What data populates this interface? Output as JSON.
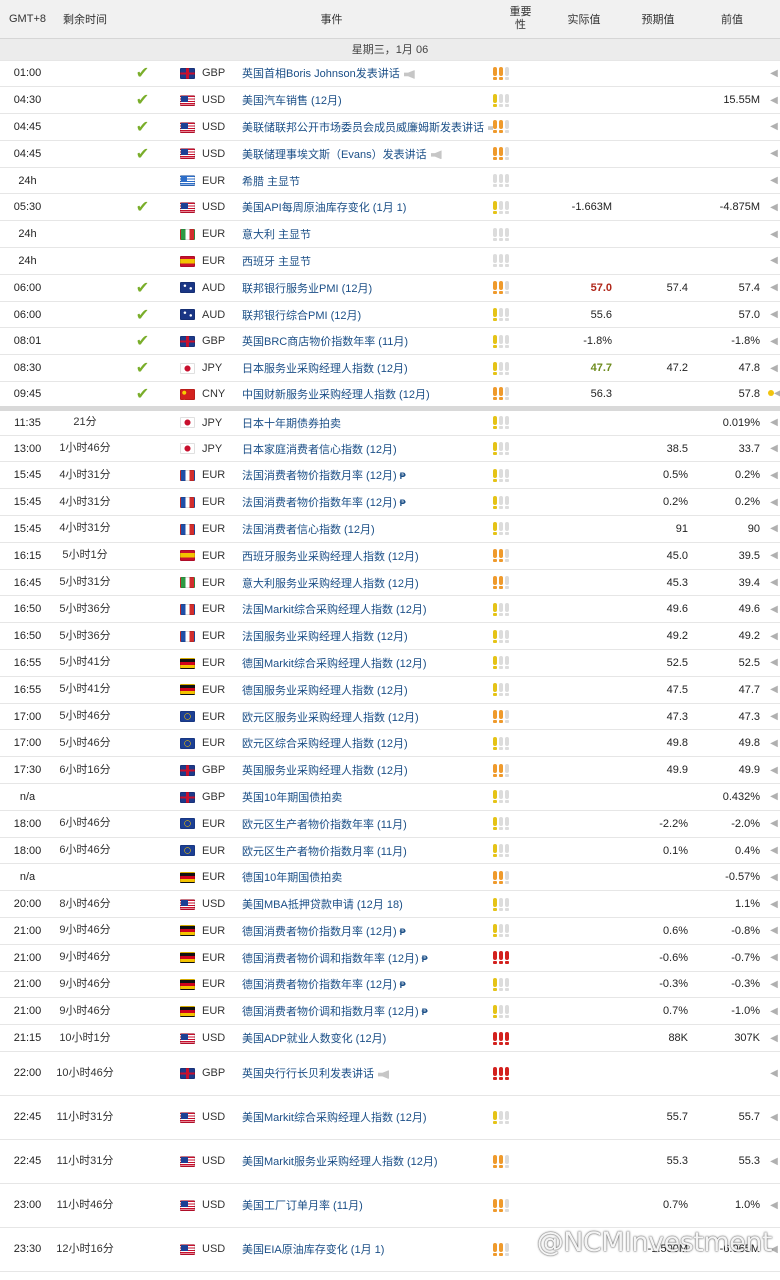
{
  "header": {
    "tz": "GMT+8",
    "remaining": "剩余时间",
    "event": "事件",
    "importance": "重要性",
    "actual": "实际值",
    "forecast": "预期值",
    "previous": "前值"
  },
  "date_label": "星期三，1月 06",
  "rows": [
    {
      "time": "01:00",
      "rem": "",
      "done": true,
      "flag": "gb",
      "cur": "GBP",
      "event": "英国首相Boris Johnson发表讲话",
      "speech": true,
      "p": false,
      "imp": "med",
      "act": "",
      "act_color": "",
      "fc": "",
      "prev": "",
      "dot": false
    },
    {
      "time": "04:30",
      "rem": "",
      "done": true,
      "flag": "us",
      "cur": "USD",
      "event": "美国汽车销售 (12月)",
      "speech": false,
      "p": false,
      "imp": "low",
      "act": "",
      "act_color": "",
      "fc": "",
      "prev": "15.55M",
      "dot": false
    },
    {
      "time": "04:45",
      "rem": "",
      "done": true,
      "flag": "us",
      "cur": "USD",
      "event": "美联储联邦公开市场委员会成员威廉姆斯发表讲话",
      "speech": true,
      "p": false,
      "imp": "med",
      "act": "",
      "act_color": "",
      "fc": "",
      "prev": "",
      "dot": false
    },
    {
      "time": "04:45",
      "rem": "",
      "done": true,
      "flag": "us",
      "cur": "USD",
      "event": "美联储理事埃文斯（Evans）发表讲话",
      "speech": true,
      "p": false,
      "imp": "med",
      "act": "",
      "act_color": "",
      "fc": "",
      "prev": "",
      "dot": false
    },
    {
      "time": "24h",
      "rem": "",
      "done": false,
      "flag": "gr",
      "cur": "EUR",
      "event": "希腊 主显节",
      "speech": false,
      "p": false,
      "imp": "none",
      "act": "",
      "act_color": "",
      "fc": "",
      "prev": "",
      "dot": false
    },
    {
      "time": "05:30",
      "rem": "",
      "done": true,
      "flag": "us",
      "cur": "USD",
      "event": "美国API每周原油库存变化 (1月 1)",
      "speech": false,
      "p": false,
      "imp": "low",
      "act": "-1.663M",
      "act_color": "",
      "fc": "",
      "prev": "-4.875M",
      "dot": false
    },
    {
      "time": "24h",
      "rem": "",
      "done": false,
      "flag": "it",
      "cur": "EUR",
      "event": "意大利 主显节",
      "speech": false,
      "p": false,
      "imp": "none",
      "act": "",
      "act_color": "",
      "fc": "",
      "prev": "",
      "dot": false
    },
    {
      "time": "24h",
      "rem": "",
      "done": false,
      "flag": "es",
      "cur": "EUR",
      "event": "西班牙 主显节",
      "speech": false,
      "p": false,
      "imp": "none",
      "act": "",
      "act_color": "",
      "fc": "",
      "prev": "",
      "dot": false
    },
    {
      "time": "06:00",
      "rem": "",
      "done": true,
      "flag": "au",
      "cur": "AUD",
      "event": "联邦银行服务业PMI (12月)",
      "speech": false,
      "p": false,
      "imp": "med",
      "act": "57.0",
      "act_color": "red",
      "fc": "57.4",
      "prev": "57.4",
      "dot": false
    },
    {
      "time": "06:00",
      "rem": "",
      "done": true,
      "flag": "au",
      "cur": "AUD",
      "event": "联邦银行综合PMI (12月)",
      "speech": false,
      "p": false,
      "imp": "low",
      "act": "55.6",
      "act_color": "",
      "fc": "",
      "prev": "57.0",
      "dot": false
    },
    {
      "time": "08:01",
      "rem": "",
      "done": true,
      "flag": "gb",
      "cur": "GBP",
      "event": "英国BRC商店物价指数年率 (11月)",
      "speech": false,
      "p": false,
      "imp": "low",
      "act": "-1.8%",
      "act_color": "",
      "fc": "",
      "prev": "-1.8%",
      "dot": false
    },
    {
      "time": "08:30",
      "rem": "",
      "done": true,
      "flag": "jp",
      "cur": "JPY",
      "event": "日本服务业采购经理人指数 (12月)",
      "speech": false,
      "p": false,
      "imp": "low",
      "act": "47.7",
      "act_color": "green",
      "fc": "47.2",
      "prev": "47.8",
      "dot": false
    },
    {
      "time": "09:45",
      "rem": "",
      "done": true,
      "flag": "cn",
      "cur": "CNY",
      "event": "中国财新服务业采购经理人指数 (12月)",
      "speech": false,
      "p": false,
      "imp": "med",
      "act": "56.3",
      "act_color": "",
      "fc": "",
      "prev": "57.8",
      "dot": true
    },
    {
      "time": "11:35",
      "rem": "21分",
      "done": false,
      "flag": "jp",
      "cur": "JPY",
      "event": "日本十年期债券拍卖",
      "speech": false,
      "p": false,
      "imp": "low",
      "act": "",
      "act_color": "",
      "fc": "",
      "prev": "0.019%",
      "dot": false,
      "sep": true
    },
    {
      "time": "13:00",
      "rem": "1小时46分",
      "done": false,
      "flag": "jp",
      "cur": "JPY",
      "event": "日本家庭消费者信心指数 (12月)",
      "speech": false,
      "p": false,
      "imp": "low",
      "act": "",
      "act_color": "",
      "fc": "38.5",
      "prev": "33.7",
      "dot": false
    },
    {
      "time": "15:45",
      "rem": "4小时31分",
      "done": false,
      "flag": "fr",
      "cur": "EUR",
      "event": "法国消费者物价指数月率 (12月)",
      "speech": false,
      "p": true,
      "imp": "low",
      "act": "",
      "act_color": "",
      "fc": "0.5%",
      "prev": "0.2%",
      "dot": false
    },
    {
      "time": "15:45",
      "rem": "4小时31分",
      "done": false,
      "flag": "fr",
      "cur": "EUR",
      "event": "法国消费者物价指数年率 (12月)",
      "speech": false,
      "p": true,
      "imp": "low",
      "act": "",
      "act_color": "",
      "fc": "0.2%",
      "prev": "0.2%",
      "dot": false
    },
    {
      "time": "15:45",
      "rem": "4小时31分",
      "done": false,
      "flag": "fr",
      "cur": "EUR",
      "event": "法国消费者信心指数 (12月)",
      "speech": false,
      "p": false,
      "imp": "low",
      "act": "",
      "act_color": "",
      "fc": "91",
      "prev": "90",
      "dot": false
    },
    {
      "time": "16:15",
      "rem": "5小时1分",
      "done": false,
      "flag": "es",
      "cur": "EUR",
      "event": "西班牙服务业采购经理人指数 (12月)",
      "speech": false,
      "p": false,
      "imp": "med",
      "act": "",
      "act_color": "",
      "fc": "45.0",
      "prev": "39.5",
      "dot": false
    },
    {
      "time": "16:45",
      "rem": "5小时31分",
      "done": false,
      "flag": "it",
      "cur": "EUR",
      "event": "意大利服务业采购经理人指数 (12月)",
      "speech": false,
      "p": false,
      "imp": "med",
      "act": "",
      "act_color": "",
      "fc": "45.3",
      "prev": "39.4",
      "dot": false
    },
    {
      "time": "16:50",
      "rem": "5小时36分",
      "done": false,
      "flag": "fr",
      "cur": "EUR",
      "event": "法国Markit综合采购经理人指数 (12月)",
      "speech": false,
      "p": false,
      "imp": "low",
      "act": "",
      "act_color": "",
      "fc": "49.6",
      "prev": "49.6",
      "dot": false
    },
    {
      "time": "16:50",
      "rem": "5小时36分",
      "done": false,
      "flag": "fr",
      "cur": "EUR",
      "event": "法国服务业采购经理人指数 (12月)",
      "speech": false,
      "p": false,
      "imp": "low",
      "act": "",
      "act_color": "",
      "fc": "49.2",
      "prev": "49.2",
      "dot": false
    },
    {
      "time": "16:55",
      "rem": "5小时41分",
      "done": false,
      "flag": "de",
      "cur": "EUR",
      "event": "德国Markit综合采购经理人指数 (12月)",
      "speech": false,
      "p": false,
      "imp": "low",
      "act": "",
      "act_color": "",
      "fc": "52.5",
      "prev": "52.5",
      "dot": false
    },
    {
      "time": "16:55",
      "rem": "5小时41分",
      "done": false,
      "flag": "de",
      "cur": "EUR",
      "event": "德国服务业采购经理人指数 (12月)",
      "speech": false,
      "p": false,
      "imp": "low",
      "act": "",
      "act_color": "",
      "fc": "47.5",
      "prev": "47.7",
      "dot": false
    },
    {
      "time": "17:00",
      "rem": "5小时46分",
      "done": false,
      "flag": "eu",
      "cur": "EUR",
      "event": "欧元区服务业采购经理人指数 (12月)",
      "speech": false,
      "p": false,
      "imp": "med",
      "act": "",
      "act_color": "",
      "fc": "47.3",
      "prev": "47.3",
      "dot": false
    },
    {
      "time": "17:00",
      "rem": "5小时46分",
      "done": false,
      "flag": "eu",
      "cur": "EUR",
      "event": "欧元区综合采购经理人指数 (12月)",
      "speech": false,
      "p": false,
      "imp": "low",
      "act": "",
      "act_color": "",
      "fc": "49.8",
      "prev": "49.8",
      "dot": false
    },
    {
      "time": "17:30",
      "rem": "6小时16分",
      "done": false,
      "flag": "gb",
      "cur": "GBP",
      "event": "英国服务业采购经理人指数 (12月)",
      "speech": false,
      "p": false,
      "imp": "med",
      "act": "",
      "act_color": "",
      "fc": "49.9",
      "prev": "49.9",
      "dot": false
    },
    {
      "time": "n/a",
      "rem": "",
      "done": false,
      "flag": "gb",
      "cur": "GBP",
      "event": "英国10年期国债拍卖",
      "speech": false,
      "p": false,
      "imp": "low",
      "act": "",
      "act_color": "",
      "fc": "",
      "prev": "0.432%",
      "dot": false
    },
    {
      "time": "18:00",
      "rem": "6小时46分",
      "done": false,
      "flag": "eu",
      "cur": "EUR",
      "event": "欧元区生产者物价指数年率 (11月)",
      "speech": false,
      "p": false,
      "imp": "low",
      "act": "",
      "act_color": "",
      "fc": "-2.2%",
      "prev": "-2.0%",
      "dot": false
    },
    {
      "time": "18:00",
      "rem": "6小时46分",
      "done": false,
      "flag": "eu",
      "cur": "EUR",
      "event": "欧元区生产者物价指数月率 (11月)",
      "speech": false,
      "p": false,
      "imp": "low",
      "act": "",
      "act_color": "",
      "fc": "0.1%",
      "prev": "0.4%",
      "dot": false
    },
    {
      "time": "n/a",
      "rem": "",
      "done": false,
      "flag": "de",
      "cur": "EUR",
      "event": "德国10年期国债拍卖",
      "speech": false,
      "p": false,
      "imp": "med",
      "act": "",
      "act_color": "",
      "fc": "",
      "prev": "-0.57%",
      "dot": false
    },
    {
      "time": "20:00",
      "rem": "8小时46分",
      "done": false,
      "flag": "us",
      "cur": "USD",
      "event": "美国MBA抵押贷款申请 (12月 18)",
      "speech": false,
      "p": false,
      "imp": "low",
      "act": "",
      "act_color": "",
      "fc": "",
      "prev": "1.1%",
      "dot": false
    },
    {
      "time": "21:00",
      "rem": "9小时46分",
      "done": false,
      "flag": "de",
      "cur": "EUR",
      "event": "德国消费者物价指数月率 (12月)",
      "speech": false,
      "p": true,
      "imp": "low",
      "act": "",
      "act_color": "",
      "fc": "0.6%",
      "prev": "-0.8%",
      "dot": false
    },
    {
      "time": "21:00",
      "rem": "9小时46分",
      "done": false,
      "flag": "de",
      "cur": "EUR",
      "event": "德国消费者物价调和指数年率 (12月)",
      "speech": false,
      "p": true,
      "imp": "high",
      "act": "",
      "act_color": "",
      "fc": "-0.6%",
      "prev": "-0.7%",
      "dot": false
    },
    {
      "time": "21:00",
      "rem": "9小时46分",
      "done": false,
      "flag": "de",
      "cur": "EUR",
      "event": "德国消费者物价指数年率 (12月)",
      "speech": false,
      "p": true,
      "imp": "low",
      "act": "",
      "act_color": "",
      "fc": "-0.3%",
      "prev": "-0.3%",
      "dot": false
    },
    {
      "time": "21:00",
      "rem": "9小时46分",
      "done": false,
      "flag": "de",
      "cur": "EUR",
      "event": "德国消费者物价调和指数月率 (12月)",
      "speech": false,
      "p": true,
      "imp": "low",
      "act": "",
      "act_color": "",
      "fc": "0.7%",
      "prev": "-1.0%",
      "dot": false
    },
    {
      "time": "21:15",
      "rem": "10小时1分",
      "done": false,
      "flag": "us",
      "cur": "USD",
      "event": "美国ADP就业人数变化 (12月)",
      "speech": false,
      "p": false,
      "imp": "high",
      "act": "",
      "act_color": "",
      "fc": "88K",
      "prev": "307K",
      "dot": false
    },
    {
      "time": "22:00",
      "rem": "10小时46分",
      "done": false,
      "flag": "gb",
      "cur": "GBP",
      "event": "英国央行行长贝利发表讲话",
      "speech": true,
      "p": false,
      "imp": "high",
      "act": "",
      "act_color": "",
      "fc": "",
      "prev": "",
      "dot": false,
      "tall": true
    },
    {
      "time": "22:45",
      "rem": "11小时31分",
      "done": false,
      "flag": "us",
      "cur": "USD",
      "event": "美国Markit综合采购经理人指数 (12月)",
      "speech": false,
      "p": false,
      "imp": "low",
      "act": "",
      "act_color": "",
      "fc": "55.7",
      "prev": "55.7",
      "dot": false,
      "tall": true
    },
    {
      "time": "22:45",
      "rem": "11小时31分",
      "done": false,
      "flag": "us",
      "cur": "USD",
      "event": "美国Markit服务业采购经理人指数 (12月)",
      "speech": false,
      "p": false,
      "imp": "med",
      "act": "",
      "act_color": "",
      "fc": "55.3",
      "prev": "55.3",
      "dot": false,
      "tall": true
    },
    {
      "time": "23:00",
      "rem": "11小时46分",
      "done": false,
      "flag": "us",
      "cur": "USD",
      "event": "美国工厂订单月率 (11月)",
      "speech": false,
      "p": false,
      "imp": "med",
      "act": "",
      "act_color": "",
      "fc": "0.7%",
      "prev": "1.0%",
      "dot": false,
      "tall": true
    },
    {
      "time": "23:30",
      "rem": "12小时16分",
      "done": false,
      "flag": "us",
      "cur": "USD",
      "event": "美国EIA原油库存变化 (1月 1)",
      "speech": false,
      "p": false,
      "imp": "med",
      "act": "",
      "act_color": "",
      "fc": "-1.500M",
      "prev": "-6.065M",
      "dot": false,
      "tall": true
    }
  ],
  "watermark": "@NCMInvestment",
  "colors": {
    "link": "#1b4f87",
    "check": "#7aae2b",
    "low": "#e5c317",
    "med": "#ef9a2c",
    "high": "#d3211e"
  }
}
